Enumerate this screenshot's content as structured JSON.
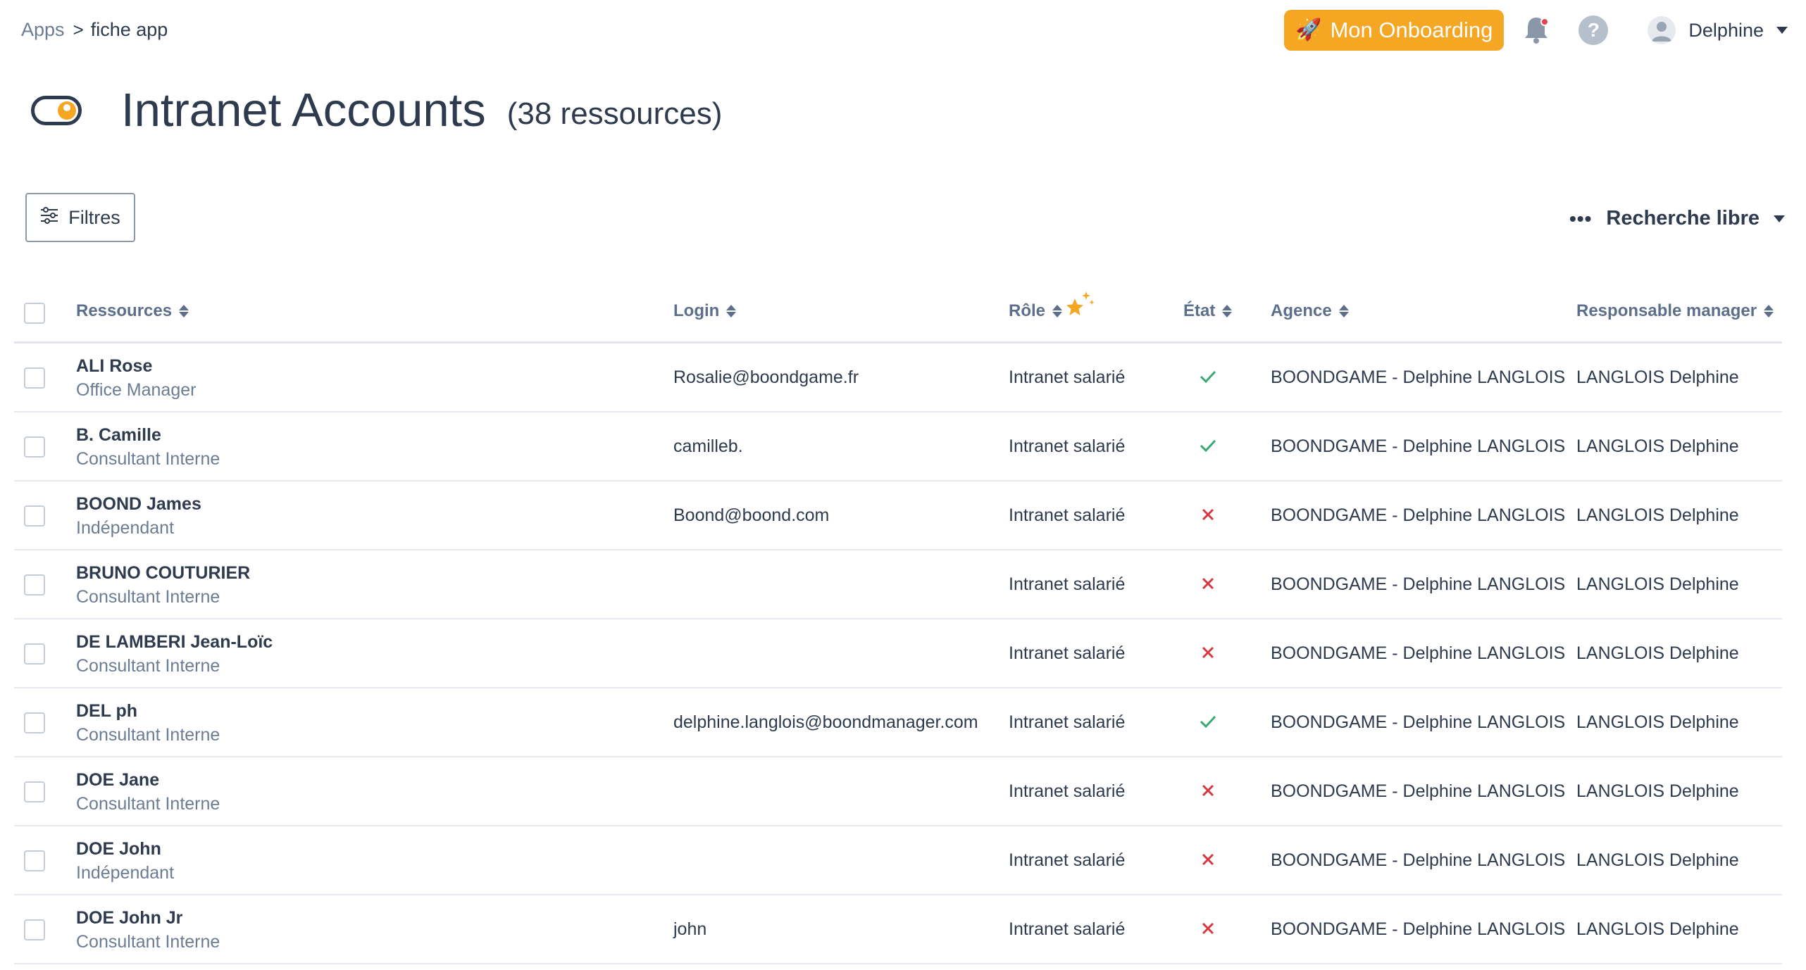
{
  "breadcrumb": {
    "root": "Apps",
    "separator": ">",
    "current": "fiche app"
  },
  "header": {
    "onboarding_label": "Mon Onboarding",
    "onboarding_color": "#f5a623",
    "help_glyph": "?",
    "user_name": "Delphine",
    "icons": [
      "rocket-icon",
      "bell-icon",
      "help-icon",
      "avatar-icon",
      "chevron-down-icon"
    ]
  },
  "page": {
    "title": "Intranet Accounts",
    "count": "(38 ressources)"
  },
  "toolbar": {
    "filters_label": "Filtres",
    "search_label": "Recherche libre"
  },
  "table": {
    "columns": {
      "ressources": "Ressources",
      "login": "Login",
      "role": "Rôle",
      "etat": "État",
      "agence": "Agence",
      "manager": "Responsable manager"
    },
    "rows": [
      {
        "name": "ALI Rose",
        "type": "Office Manager",
        "login": "Rosalie@boondgame.fr",
        "role": "Intranet salarié",
        "etat": "active",
        "agence": "BOONDGAME - Delphine LANGLOIS",
        "manager": "LANGLOIS Delphine"
      },
      {
        "name": "B. Camille",
        "type": "Consultant Interne",
        "login": "camilleb.",
        "role": "Intranet salarié",
        "etat": "active",
        "agence": "BOONDGAME - Delphine LANGLOIS",
        "manager": "LANGLOIS Delphine"
      },
      {
        "name": "BOOND James",
        "type": "Indépendant",
        "login": "Boond@boond.com",
        "role": "Intranet salarié",
        "etat": "inactive",
        "agence": "BOONDGAME - Delphine LANGLOIS",
        "manager": "LANGLOIS Delphine"
      },
      {
        "name": "BRUNO COUTURIER",
        "type": "Consultant Interne",
        "login": "",
        "role": "Intranet salarié",
        "etat": "inactive",
        "agence": "BOONDGAME - Delphine LANGLOIS",
        "manager": "LANGLOIS Delphine"
      },
      {
        "name": "DE LAMBERI Jean-Loïc",
        "type": "Consultant Interne",
        "login": "",
        "role": "Intranet salarié",
        "etat": "inactive",
        "agence": "BOONDGAME - Delphine LANGLOIS",
        "manager": "LANGLOIS Delphine"
      },
      {
        "name": "DEL ph",
        "type": "Consultant Interne",
        "login": "delphine.langlois@boondmanager.com",
        "role": "Intranet salarié",
        "etat": "active",
        "agence": "BOONDGAME - Delphine LANGLOIS",
        "manager": "LANGLOIS Delphine"
      },
      {
        "name": "DOE Jane",
        "type": "Consultant Interne",
        "login": "",
        "role": "Intranet salarié",
        "etat": "inactive",
        "agence": "BOONDGAME - Delphine LANGLOIS",
        "manager": "LANGLOIS Delphine"
      },
      {
        "name": "DOE John",
        "type": "Indépendant",
        "login": "",
        "role": "Intranet salarié",
        "etat": "inactive",
        "agence": "BOONDGAME - Delphine LANGLOIS",
        "manager": "LANGLOIS Delphine"
      },
      {
        "name": "DOE John Jr",
        "type": "Consultant Interne",
        "login": "john",
        "role": "Intranet salarié",
        "etat": "inactive",
        "agence": "BOONDGAME - Delphine LANGLOIS",
        "manager": "LANGLOIS Delphine"
      }
    ]
  },
  "colors": {
    "check": "#3aa876",
    "cross": "#d9363e",
    "accent": "#f5a623",
    "text": "#2e3a4d"
  }
}
